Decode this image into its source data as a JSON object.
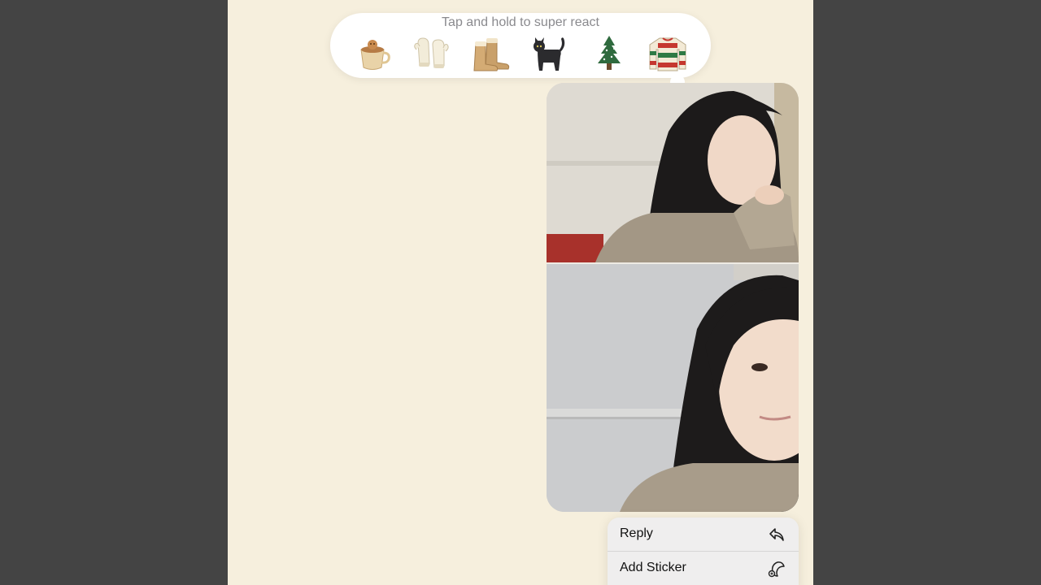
{
  "reaction_bar": {
    "hint": "Tap and hold to super react",
    "emojis": [
      {
        "name": "hot-cocoa-icon"
      },
      {
        "name": "mittens-icon"
      },
      {
        "name": "boots-icon"
      },
      {
        "name": "black-cat-icon"
      },
      {
        "name": "christmas-tree-icon"
      },
      {
        "name": "holiday-sweater-icon"
      }
    ]
  },
  "message": {
    "photos": [
      {
        "name": "photo-1"
      },
      {
        "name": "photo-2"
      }
    ]
  },
  "context_menu": {
    "items": [
      {
        "label": "Reply",
        "icon": "reply-arrow-icon"
      },
      {
        "label": "Add Sticker",
        "icon": "sticker-icon"
      }
    ]
  },
  "colors": {
    "background": "#f6efdd",
    "outer": "#444444",
    "bubble": "#ffffff",
    "menu": "#efeeee"
  }
}
